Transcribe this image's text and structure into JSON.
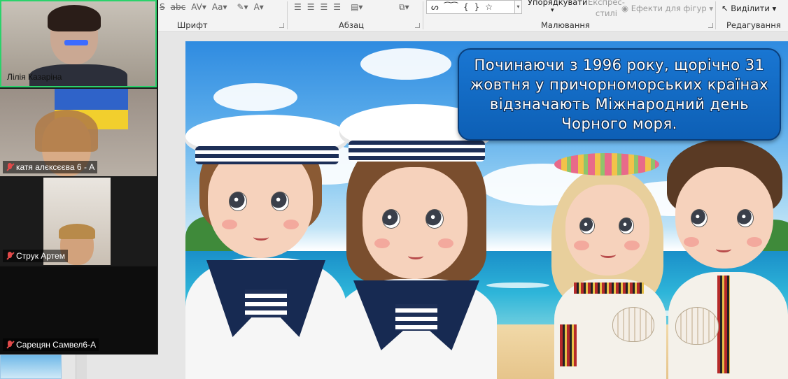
{
  "ribbon": {
    "groups": [
      "Шрифт",
      "Абзац",
      "Малювання",
      "Редагування"
    ],
    "arrange_label": "Упорядкувати",
    "express_styles_label": "Експрес-\nстилі",
    "shape_effects_label": "Ефекти для фігур",
    "select_label": "Виділити",
    "font_glyphs": [
      "S",
      "abc",
      "AV",
      "Aa"
    ]
  },
  "slide": {
    "callout_text": "Починаючи з 1996 року, щорічно 31 жовтня у причорноморських країнах відзначають Міжнародний день Чорного моря."
  },
  "participants": [
    {
      "name": "Лілія Казаріна",
      "muted": false,
      "active": true
    },
    {
      "name": "катя алєксєєва 6 - А",
      "muted": true,
      "active": false
    },
    {
      "name": "Струк Артем",
      "muted": true,
      "active": false
    },
    {
      "name": "Сарецян Самвел6-А",
      "muted": true,
      "active": false
    }
  ],
  "colors": {
    "active_speaker_border": "#2bd26b",
    "muted_icon": "#e24a4a",
    "callout_fill": "#1976d2"
  }
}
